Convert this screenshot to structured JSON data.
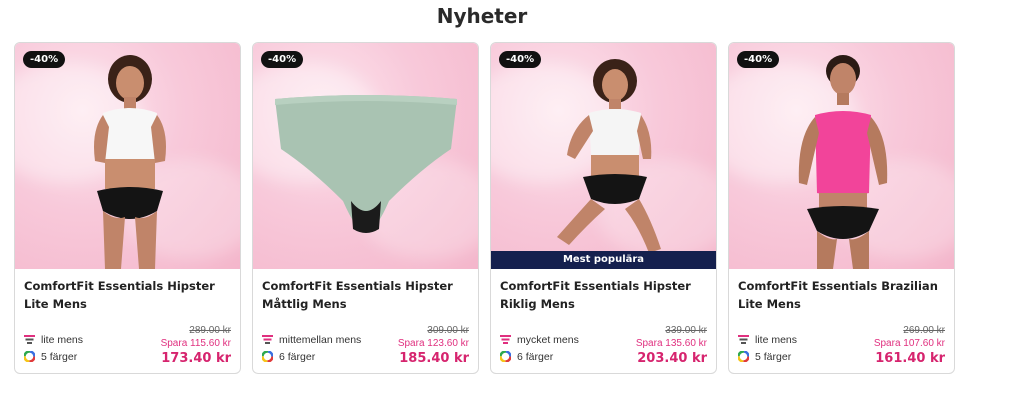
{
  "section": {
    "title": "Nyheter"
  },
  "products": [
    {
      "badge": "-40%",
      "name": "ComfortFit Essentials Hipster Lite Mens",
      "absorbency": "lite mens",
      "colors": "5 färger",
      "old_price": "289.00 kr",
      "save": "Spara 115.60 kr",
      "price": "173.40 kr",
      "image": "woman-white-tank-black-hipster"
    },
    {
      "badge": "-40%",
      "name": "ComfortFit Essentials Hipster Måttlig Mens",
      "absorbency": "mittemellan mens",
      "colors": "6 färger",
      "old_price": "309.00 kr",
      "save": "Spara 123.60 kr",
      "price": "185.40 kr",
      "image": "sage-green-hipster-product"
    },
    {
      "badge": "-40%",
      "banner": "Mest populära",
      "name": "ComfortFit Essentials Hipster Riklig Mens",
      "absorbency": "mycket mens",
      "colors": "6 färger",
      "old_price": "339.00 kr",
      "save": "Spara 135.60 kr",
      "price": "203.40 kr",
      "image": "woman-white-tank-black-hipster-posing"
    },
    {
      "badge": "-40%",
      "name": "ComfortFit Essentials Brazilian Lite Mens",
      "absorbency": "lite mens",
      "colors": "5 färger",
      "old_price": "269.00 kr",
      "save": "Spara 107.60 kr",
      "price": "161.40 kr",
      "image": "woman-pink-tank-black-brazilian"
    }
  ],
  "colors": {
    "price": "#d6246e",
    "save": "#e0307f",
    "badge_bg": "#111111",
    "banner_bg": "#15204e"
  }
}
